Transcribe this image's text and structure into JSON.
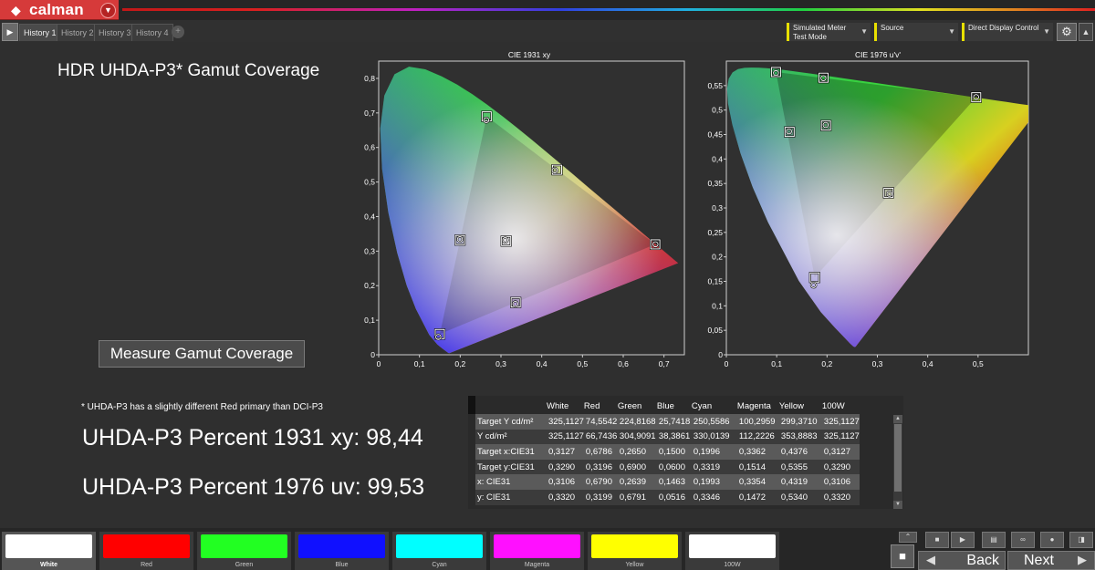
{
  "app": {
    "logo": "calman",
    "logo_mark": "◆"
  },
  "tabs": [
    "History 1",
    "History 2",
    "History 3",
    "History 4"
  ],
  "toolbar": {
    "meter_line1": "Simulated Meter",
    "meter_line2": "Test Mode",
    "source": "Source",
    "ddc": "Direct Display Control"
  },
  "page": {
    "title": "HDR UHDA-P3* Gamut Coverage",
    "measure_button": "Measure Gamut Coverage",
    "note": "* UHDA-P3 has a slightly different Red primary than DCI-P3",
    "result_1931": "UHDA-P3 Percent 1931 xy: 98,44",
    "result_1976": "UHDA-P3 Percent 1976 uv: 99,53"
  },
  "chart_data": [
    {
      "type": "scatter",
      "title": "CIE 1931 xy",
      "xlim": [
        0,
        0.75
      ],
      "ylim": [
        0,
        0.85
      ],
      "xticks": [
        "0",
        "0,1",
        "0,2",
        "0,3",
        "0,4",
        "0,5",
        "0,6",
        "0,7"
      ],
      "yticks": [
        "0",
        "0,1",
        "0,2",
        "0,3",
        "0,4",
        "0,5",
        "0,6",
        "0,7",
        "0,8"
      ],
      "series": [
        {
          "points": [
            [
              0.6786,
              0.3196
            ],
            [
              0.265,
              0.69
            ],
            [
              0.15,
              0.06
            ],
            [
              0.1996,
              0.3319
            ],
            [
              0.3362,
              0.1514
            ],
            [
              0.4376,
              0.5355
            ],
            [
              0.3127,
              0.329
            ]
          ]
        },
        {
          "points": [
            [
              0.679,
              0.3199
            ],
            [
              0.2639,
              0.6791
            ],
            [
              0.1463,
              0.0516
            ],
            [
              0.1993,
              0.3346
            ],
            [
              0.3354,
              0.1472
            ],
            [
              0.4319,
              0.534
            ],
            [
              0.3106,
              0.332
            ]
          ]
        }
      ]
    },
    {
      "type": "scatter",
      "title": "CIE 1976 u'v'",
      "xlim": [
        0,
        0.6
      ],
      "ylim": [
        0,
        0.6
      ],
      "xticks": [
        "0",
        "0,1",
        "0,2",
        "0,3",
        "0,4",
        "0,5"
      ],
      "yticks": [
        "0",
        "0,05",
        "0,1",
        "0,15",
        "0,2",
        "0,25",
        "0,3",
        "0,35",
        "0,4",
        "0,45",
        "0,5",
        "0,55"
      ],
      "series": [
        {
          "points": [
            [
              0.4963,
              0.5261
            ],
            [
              0.0986,
              0.5777
            ],
            [
              0.1754,
              0.1579
            ],
            [
              0.1256,
              0.4553
            ],
            [
              0.3221,
              0.3309
            ],
            [
              0.193,
              0.5661
            ],
            [
              0.1979,
              0.4683
            ]
          ]
        },
        {
          "points": [
            [
              0.4962,
              0.5265
            ],
            [
              0.0986,
              0.5757
            ],
            [
              0.1733,
              0.1423
            ],
            [
              0.1244,
              0.4564
            ],
            [
              0.3241,
              0.3288
            ],
            [
              0.1928,
              0.5651
            ],
            [
              0.1973,
              0.4695
            ]
          ]
        }
      ]
    }
  ],
  "table": {
    "columns": [
      "",
      "White",
      "Red",
      "Green",
      "Blue",
      "Cyan",
      "Magenta",
      "Yellow",
      "100W"
    ],
    "rows": [
      [
        "Target Y cd/m²",
        "325,1127",
        "74,5542",
        "224,8168",
        "25,7418",
        "250,5586",
        "100,2959",
        "299,3710",
        "325,1127"
      ],
      [
        "Y cd/m²",
        "325,1127",
        "66,7436",
        "304,9091",
        "38,3861",
        "330,0139",
        "112,2226",
        "353,8883",
        "325,1127"
      ],
      [
        "Target x:CIE31",
        "0,3127",
        "0,6786",
        "0,2650",
        "0,1500",
        "0,1996",
        "0,3362",
        "0,4376",
        "0,3127"
      ],
      [
        "Target y:CIE31",
        "0,3290",
        "0,3196",
        "0,6900",
        "0,0600",
        "0,3319",
        "0,1514",
        "0,5355",
        "0,3290"
      ],
      [
        "x: CIE31",
        "0,3106",
        "0,6790",
        "0,2639",
        "0,1463",
        "0,1993",
        "0,3354",
        "0,4319",
        "0,3106"
      ],
      [
        "y: CIE31",
        "0,3320",
        "0,3199",
        "0,6791",
        "0,0516",
        "0,3346",
        "0,1472",
        "0,5340",
        "0,3320"
      ]
    ]
  },
  "patches": [
    {
      "label": "White",
      "color": "#ffffff"
    },
    {
      "label": "Red",
      "color": "#ff0000"
    },
    {
      "label": "Green",
      "color": "#22ff22"
    },
    {
      "label": "Blue",
      "color": "#1010ff"
    },
    {
      "label": "Cyan",
      "color": "#00ffff"
    },
    {
      "label": "Magenta",
      "color": "#ff10ff"
    },
    {
      "label": "Yellow",
      "color": "#ffff00"
    },
    {
      "label": "100W",
      "color": "#ffffff"
    }
  ],
  "nav": {
    "back": "Back",
    "next": "Next"
  }
}
